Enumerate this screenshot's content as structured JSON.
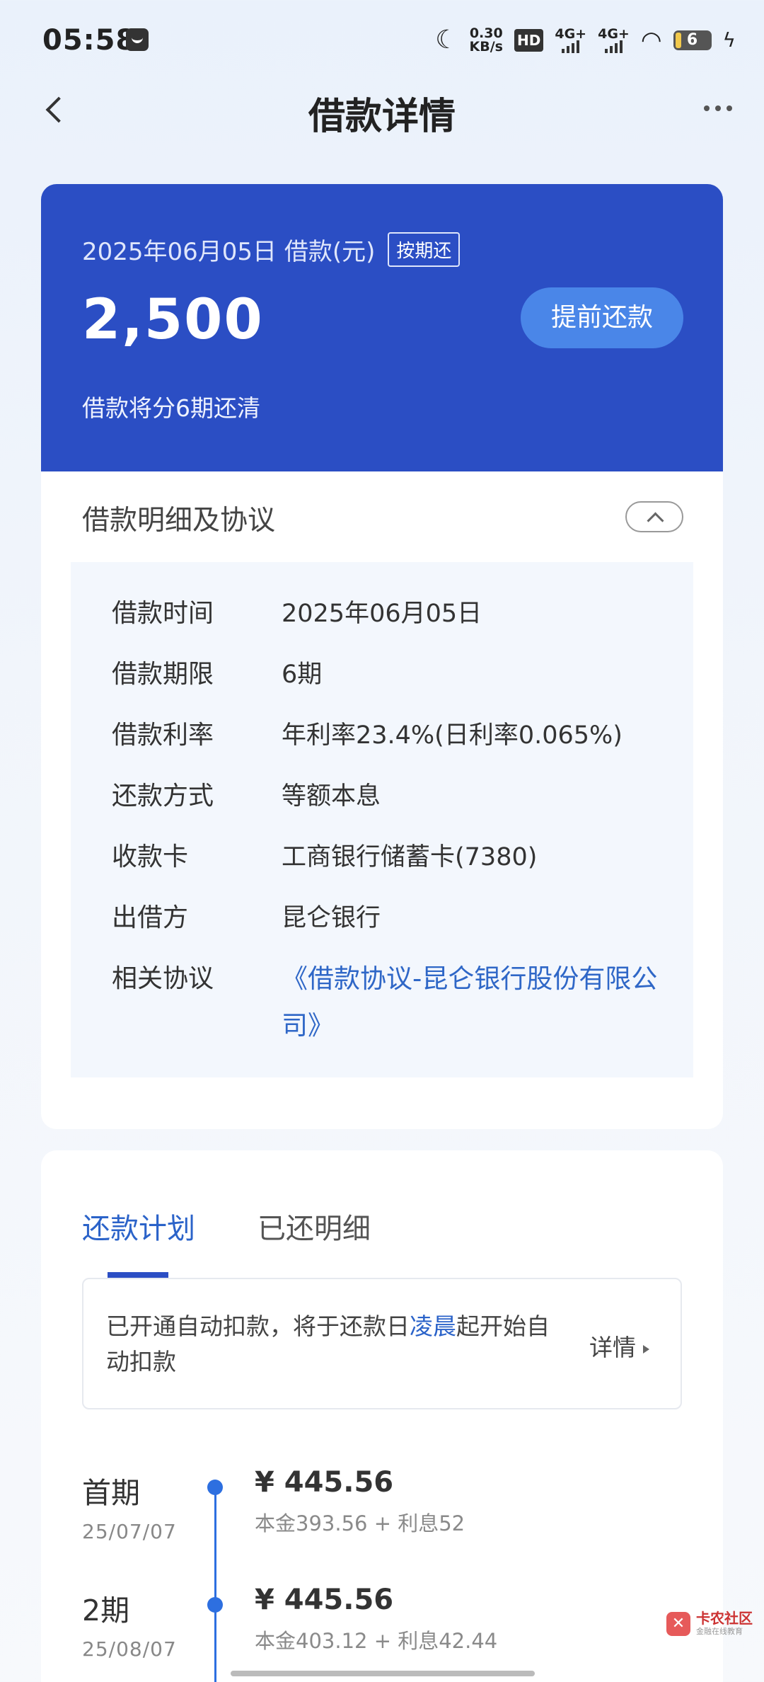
{
  "status_bar": {
    "time": "05:58",
    "net_speed_value": "0.30",
    "net_speed_unit": "KB/s",
    "hd_label": "HD",
    "signal1": "4G+",
    "signal2": "4G+",
    "battery": "6"
  },
  "nav": {
    "title": "借款详情"
  },
  "loan": {
    "date_label": "2025年06月05日 借款(元)",
    "repay_badge": "按期还",
    "amount": "2,500",
    "prepay_button": "提前还款",
    "note": "借款将分6期还清"
  },
  "details": {
    "section_title": "借款明细及协议",
    "rows": [
      {
        "label": "借款时间",
        "value": "2025年06月05日"
      },
      {
        "label": "借款期限",
        "value": "6期"
      },
      {
        "label": "借款利率",
        "value": "年利率23.4%(日利率0.065%)"
      },
      {
        "label": "还款方式",
        "value": "等额本息"
      },
      {
        "label": "收款卡",
        "value": "工商银行储蓄卡(7380)"
      },
      {
        "label": "出借方",
        "value": "昆仑银行"
      },
      {
        "label": "相关协议",
        "value": "《借款协议-昆仑银行股份有限公司》"
      }
    ]
  },
  "plan": {
    "tabs": [
      {
        "label": "还款计划"
      },
      {
        "label": "已还明细"
      }
    ],
    "notice_prefix": "已开通自动扣款，将于还款日",
    "notice_highlight": "凌晨",
    "notice_suffix": "起开始自动扣款",
    "notice_detail": "详情",
    "terms": [
      {
        "name": "首期",
        "date": "25/07/07",
        "amount": "¥ 445.56",
        "breakdown": "本金393.56 + 利息52"
      },
      {
        "name": "2期",
        "date": "25/08/07",
        "amount": "¥ 445.56",
        "breakdown": "本金403.12 + 利息42.44"
      }
    ]
  },
  "watermark": {
    "title": "卡农社区",
    "subtitle": "金融在线教育"
  }
}
